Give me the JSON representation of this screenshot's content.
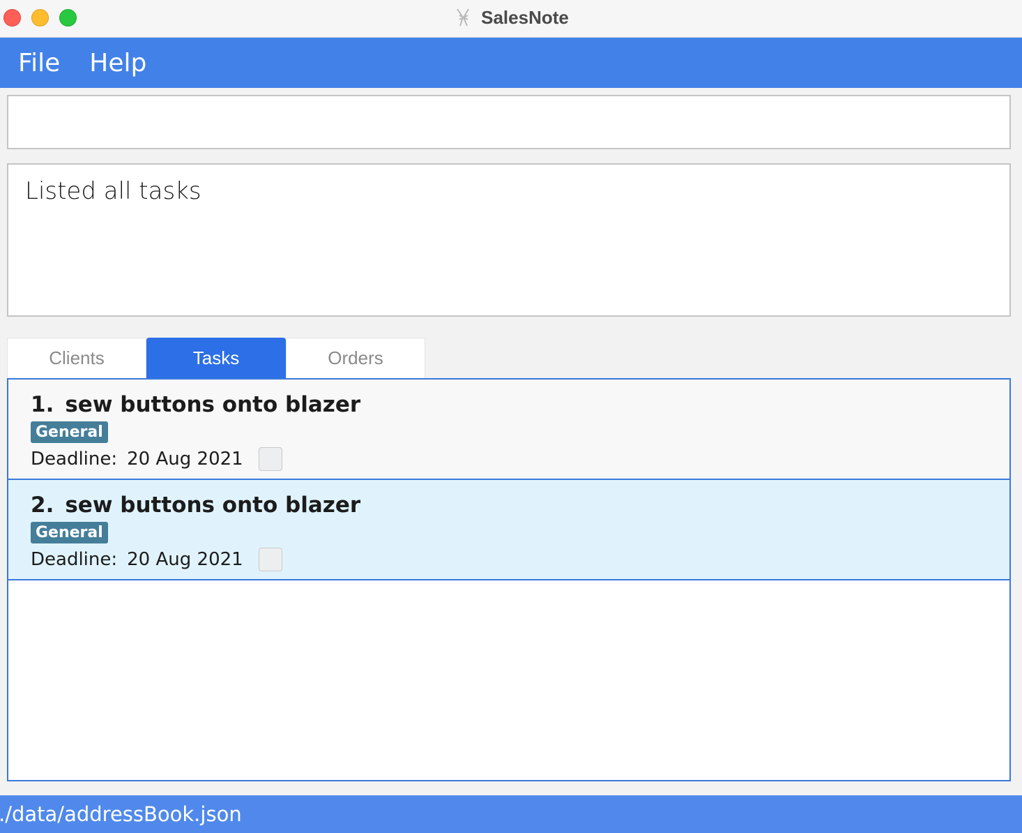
{
  "window": {
    "title": "SalesNote"
  },
  "menu": {
    "file": "File",
    "help": "Help"
  },
  "command": {
    "value": "",
    "placeholder": ""
  },
  "result": {
    "text": "Listed all tasks"
  },
  "tabs": [
    {
      "label": "Clients",
      "active": false
    },
    {
      "label": "Tasks",
      "active": true
    },
    {
      "label": "Orders",
      "active": false
    }
  ],
  "tasks": [
    {
      "index": "1.",
      "title": "sew buttons onto blazer",
      "tag": "General",
      "deadline_label": "Deadline:",
      "deadline": "20 Aug 2021",
      "done": false
    },
    {
      "index": "2.",
      "title": "sew buttons onto blazer",
      "tag": "General",
      "deadline_label": "Deadline:",
      "deadline": "20 Aug 2021",
      "done": false,
      "selected": true
    }
  ],
  "status": {
    "path": "./data/addressBook.json"
  },
  "colors": {
    "accent": "#4281e8",
    "active_tab": "#2c6fe6",
    "tag": "#447e99",
    "selected_row": "#e0f3fc"
  }
}
